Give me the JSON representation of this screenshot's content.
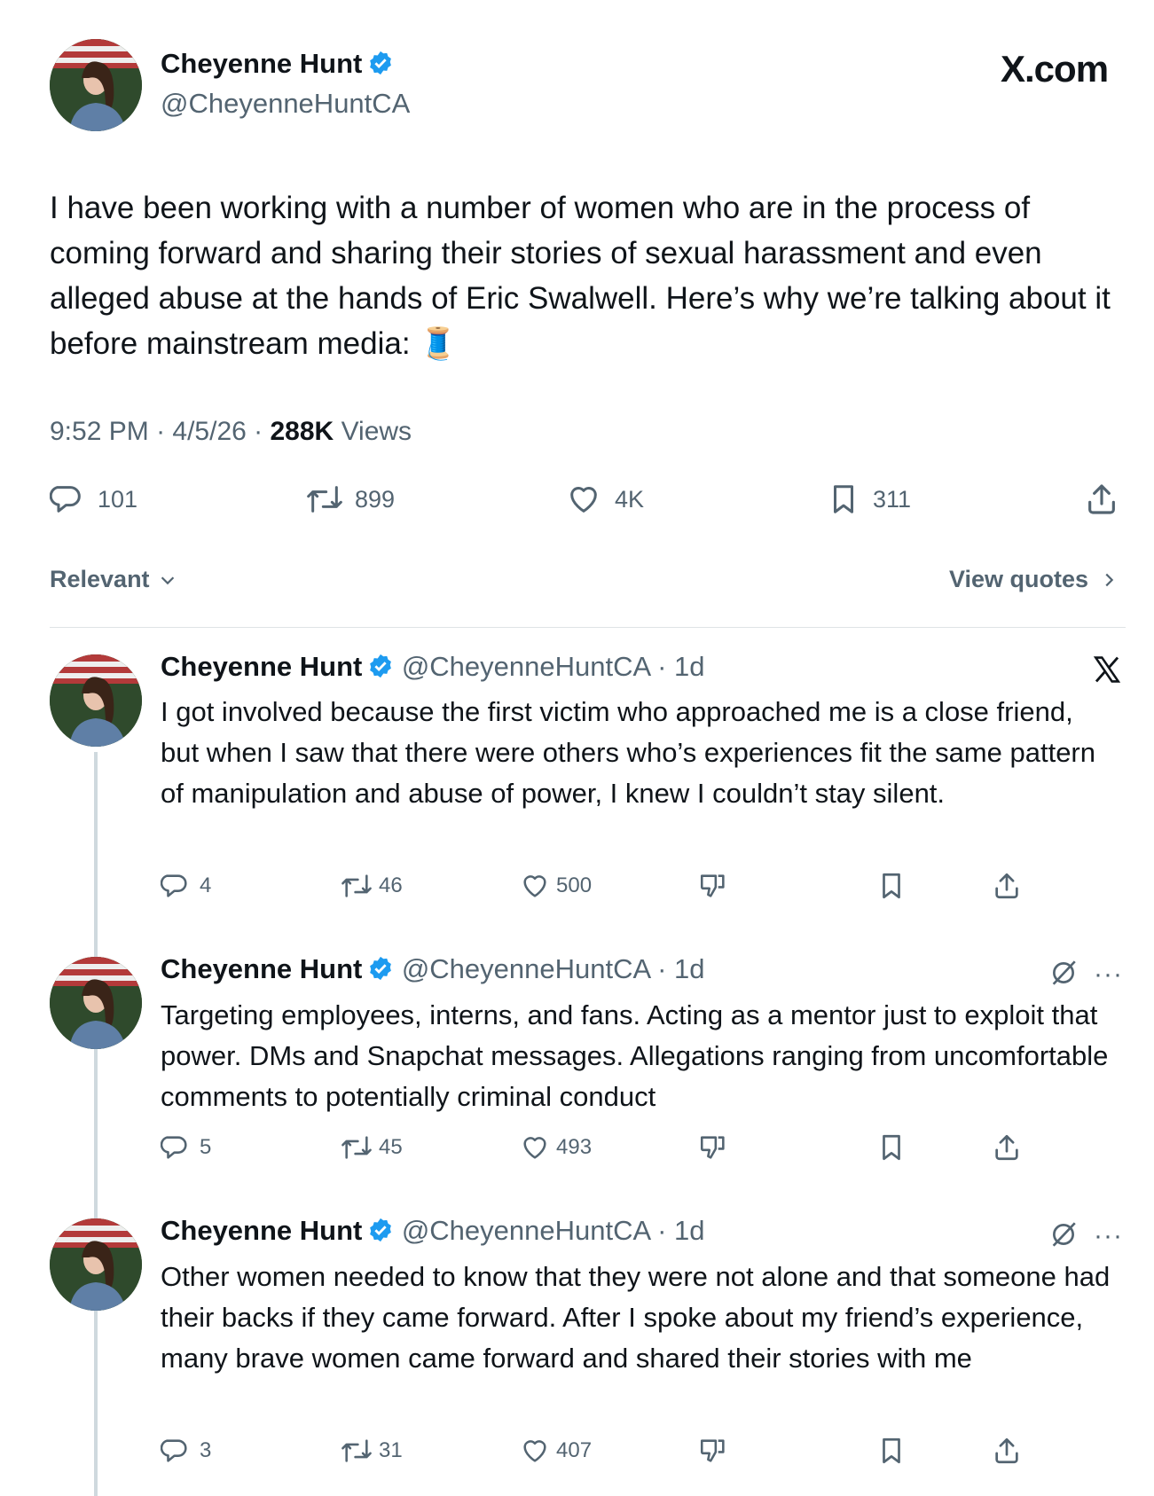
{
  "brand": {
    "watermark": "X.com"
  },
  "main_tweet": {
    "author_name": "Cheyenne Hunt",
    "author_handle": "@CheyenneHuntCA",
    "text": "I have been working with a number of women who are in the process of coming forward and sharing their stories of sexual harassment and even alleged abuse at the hands of Eric Swalwell. Here’s why we’re talking about it before mainstream media: 🧵",
    "time": "9:52 PM",
    "date": "4/5/26",
    "views_count": "288K",
    "views_label": "Views",
    "replies": "101",
    "reposts": "899",
    "likes": "4K",
    "bookmarks": "311"
  },
  "sort": {
    "label": "Relevant",
    "quotes_link": "View quotes"
  },
  "replies": [
    {
      "author_name": "Cheyenne Hunt",
      "author_handle": "@CheyenneHuntCA",
      "age": "1d",
      "text": "I got involved because the first victim who approached me is a close friend, but when I saw that there were others who’s experiences fit the same pattern of manipulation and abuse of power, I knew I couldn’t stay silent.",
      "replies": "4",
      "reposts": "46",
      "likes": "500"
    },
    {
      "author_name": "Cheyenne Hunt",
      "author_handle": "@CheyenneHuntCA",
      "age": "1d",
      "text": "Targeting employees, interns, and fans. Acting as a mentor just to exploit that power. DMs and Snapchat messages. Allegations ranging from uncomfortable comments to potentially criminal conduct",
      "replies": "5",
      "reposts": "45",
      "likes": "493"
    },
    {
      "author_name": "Cheyenne Hunt",
      "author_handle": "@CheyenneHuntCA",
      "age": "1d",
      "text": "Other women needed to know that they were not alone and that someone had their backs if they came forward. After I spoke about my friend’s experience, many brave women came forward and shared their stories with me",
      "replies": "3",
      "reposts": "31",
      "likes": "407"
    }
  ],
  "colors": {
    "verified": "#1d9bf0",
    "muted": "#536471",
    "text": "#0f1419",
    "divider": "#dfe3e6"
  }
}
